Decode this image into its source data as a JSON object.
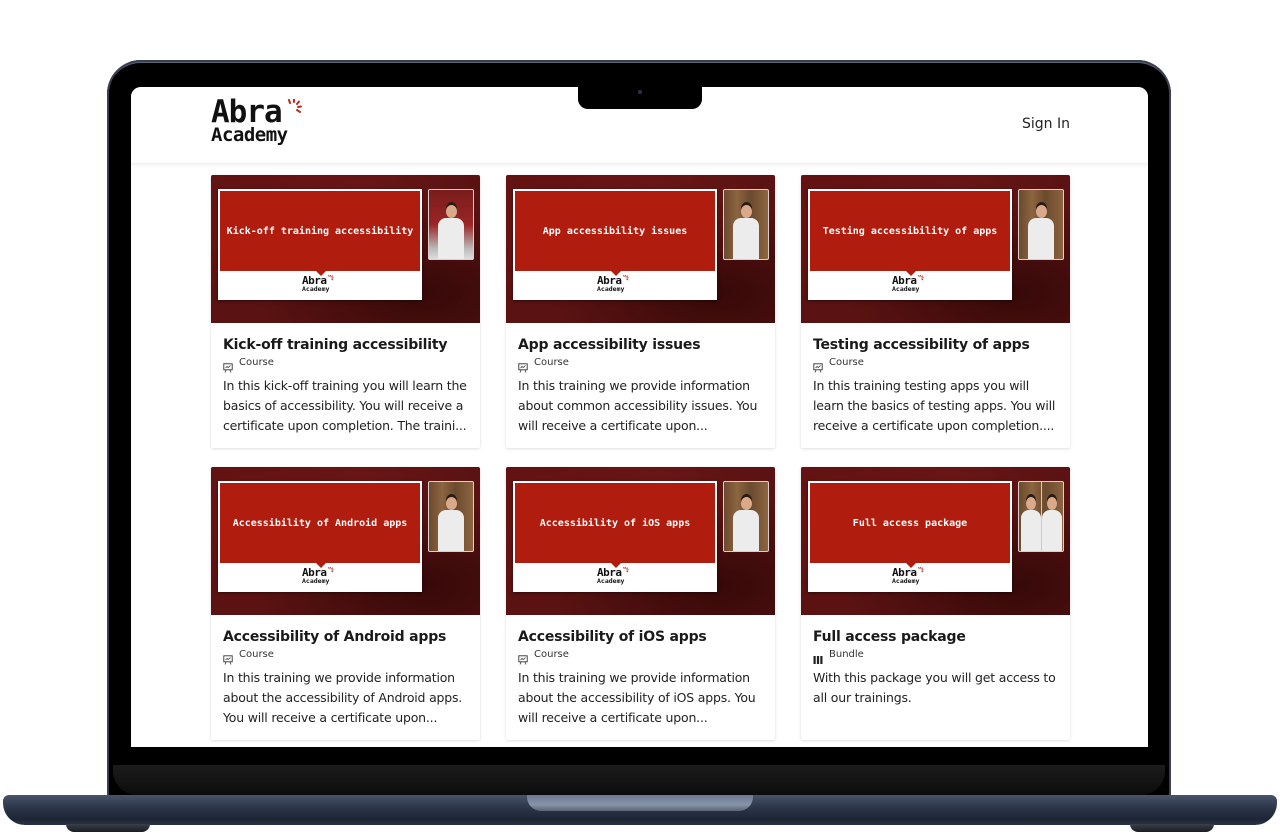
{
  "header": {
    "logo_line1": "Abra",
    "logo_line2": "Academy",
    "sign_in_label": "Sign In"
  },
  "colors": {
    "brand_red": "#b01c0e",
    "thumb_bg": "#5a1212"
  },
  "cards": [
    {
      "title": "Kick-off training accessibility",
      "thumb_title": "Kick-off training accessibility",
      "type": "Course",
      "type_icon": "presentation-icon",
      "description": "In this kick-off training you will learn the basics of accessibility. You will receive a certificate upon completion. The traini..."
    },
    {
      "title": "App accessibility issues",
      "thumb_title": "App accessibility issues",
      "type": "Course",
      "type_icon": "presentation-icon",
      "description": "In this training we provide information about common accessibility issues. You will receive a certificate upon..."
    },
    {
      "title": "Testing accessibility of apps",
      "thumb_title": "Testing accessibility of apps",
      "type": "Course",
      "type_icon": "presentation-icon",
      "description": "In this training testing apps you will learn the basics of testing apps. You will receive a certificate upon completion...."
    },
    {
      "title": "Accessibility of Android apps",
      "thumb_title": "Accessibility of Android apps",
      "type": "Course",
      "type_icon": "presentation-icon",
      "description": "In this training we provide information about the accessibility of Android apps. You will receive a certificate upon..."
    },
    {
      "title": "Accessibility of iOS apps",
      "thumb_title": "Accessibility of iOS apps",
      "type": "Course",
      "type_icon": "presentation-icon",
      "description": "In this training we provide information about the accessibility of iOS apps. You will receive a certificate upon..."
    },
    {
      "title": "Full access package",
      "thumb_title": "Full access package",
      "type": "Bundle",
      "type_icon": "bundle-icon",
      "description": "With this package you will get access to all our trainings."
    }
  ]
}
